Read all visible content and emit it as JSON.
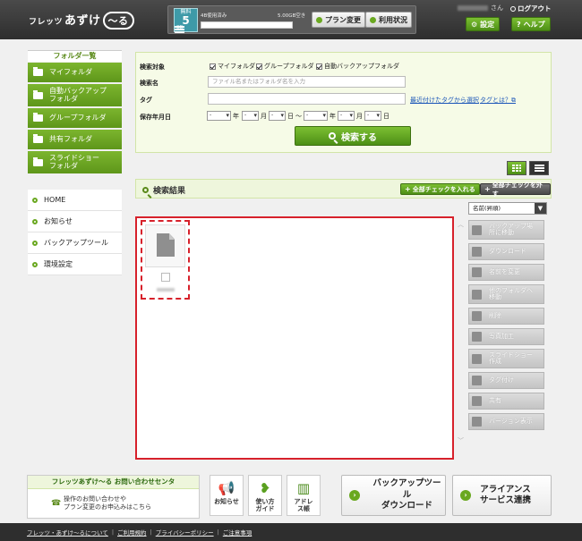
{
  "header": {
    "logo_small": "フレッツ",
    "logo_main": "あずけ",
    "logo_tail": "〜る",
    "plan_badge_top": "無料",
    "plan_badge_size": "5",
    "plan_badge_unit": "GB",
    "usage_used": "4B使用済み",
    "usage_free": "5.00GB空き",
    "usage_fraction": 0.0,
    "plan_change_label": "プラン変更",
    "usage_status_label": "利用状況",
    "user_suffix": "さん",
    "logout_label": "ログアウト",
    "settings_label": "設定",
    "help_label": "ヘルプ"
  },
  "sidebar": {
    "folder_title": "フォルダ一覧",
    "folders": [
      {
        "label": "マイフォルダ"
      },
      {
        "label": "自動バックアップフォルダ"
      },
      {
        "label": "グループフォルダ"
      },
      {
        "label": "共有フォルダ"
      },
      {
        "label": "スライドショーフォルダ"
      }
    ],
    "nav": [
      {
        "label": "HOME"
      },
      {
        "label": "お知らせ"
      },
      {
        "label": "バックアップツール"
      },
      {
        "label": "環境設定"
      }
    ]
  },
  "search": {
    "target_label": "検索対象",
    "targets": [
      "マイフォルダ",
      "グループフォルダ",
      "自動バックアップフォルダ"
    ],
    "name_label": "検索名",
    "name_placeholder": "ファイル名またはフォルダ名を入力",
    "tag_label": "タグ",
    "recent_tags_link": "最近付けたタグから選択",
    "what_is_tag_link": "タグとは？",
    "date_label": "保存年月日",
    "date_year": "年",
    "date_month": "月",
    "date_day": "日",
    "date_tilde": "〜",
    "select_placeholder": "-",
    "submit_label": "検索する"
  },
  "results": {
    "title": "検索結果",
    "check_all_label": "全部チェックを入れる",
    "uncheck_all_label": "全部チェックを外す",
    "sort_value": "名前(昇順)",
    "actions": [
      {
        "label": "バックアップ場所に移動",
        "icon": "arrow-left-icon"
      },
      {
        "label": "ダウンロード",
        "icon": "download-icon"
      },
      {
        "label": "名前を変更",
        "icon": "pencil-icon"
      },
      {
        "label": "他のフォルダへ移動",
        "icon": "folder-move-icon"
      },
      {
        "label": "削除",
        "icon": "trash-icon"
      },
      {
        "label": "写真加工",
        "icon": "camera-icon"
      },
      {
        "label": "スライドショー作成",
        "icon": "slideshow-icon"
      },
      {
        "label": "タグ付け",
        "icon": "tag-icon"
      },
      {
        "label": "共有",
        "icon": "share-icon"
      },
      {
        "label": "バージョン表示",
        "icon": "version-icon"
      }
    ]
  },
  "footer": {
    "contact_title": "フレッツあずけ〜る お問い合わせセンタ",
    "contact_line1": "操作のお問い合わせや",
    "contact_line2": "プラン変更のお申込みはこちら",
    "tiles": [
      {
        "label": "お知らせ",
        "icon": "megaphone-icon"
      },
      {
        "label": "使い方ガイド",
        "icon": "beginner-icon"
      },
      {
        "label": "アドレス帳",
        "icon": "address-book-icon"
      }
    ],
    "backup_tool_line1": "バックアップツール",
    "backup_tool_line2": "ダウンロード",
    "alliance_line1": "アライアンス",
    "alliance_line2": "サービス連携",
    "links": [
      "フレッツ・あずけ〜るについて",
      "ご利用規約",
      "プライバシーポリシー",
      "ご注意事項"
    ]
  },
  "colors": {
    "brand_green": "#6aa820",
    "highlight_red": "#d7212b",
    "header_dark": "#3a3a3a"
  }
}
